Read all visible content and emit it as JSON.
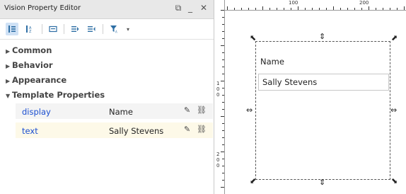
{
  "panel": {
    "title": "Vision Property Editor",
    "window_buttons": [
      "⧉",
      "_",
      "✕"
    ],
    "toolbar_icons": [
      "sort-order-icon",
      "sort-alpha-icon",
      "show-description-icon",
      "expand-all-icon",
      "collapse-all-icon",
      "filter-icon",
      "filter-dropdown-icon"
    ],
    "categories": [
      {
        "label": "Common",
        "expanded": false
      },
      {
        "label": "Behavior",
        "expanded": false
      },
      {
        "label": "Appearance",
        "expanded": false
      },
      {
        "label": "Template Properties",
        "expanded": true
      }
    ],
    "properties": [
      {
        "name": "display",
        "value": "Name"
      },
      {
        "name": "text",
        "value": "Sally Stevens"
      }
    ]
  },
  "canvas": {
    "ruler_labels": [
      "100",
      "200"
    ],
    "vruler_labels": [
      "1",
      "0",
      "0",
      "2",
      "0",
      "0"
    ],
    "template_label": "Name",
    "template_field_value": "Sally Stevens"
  }
}
